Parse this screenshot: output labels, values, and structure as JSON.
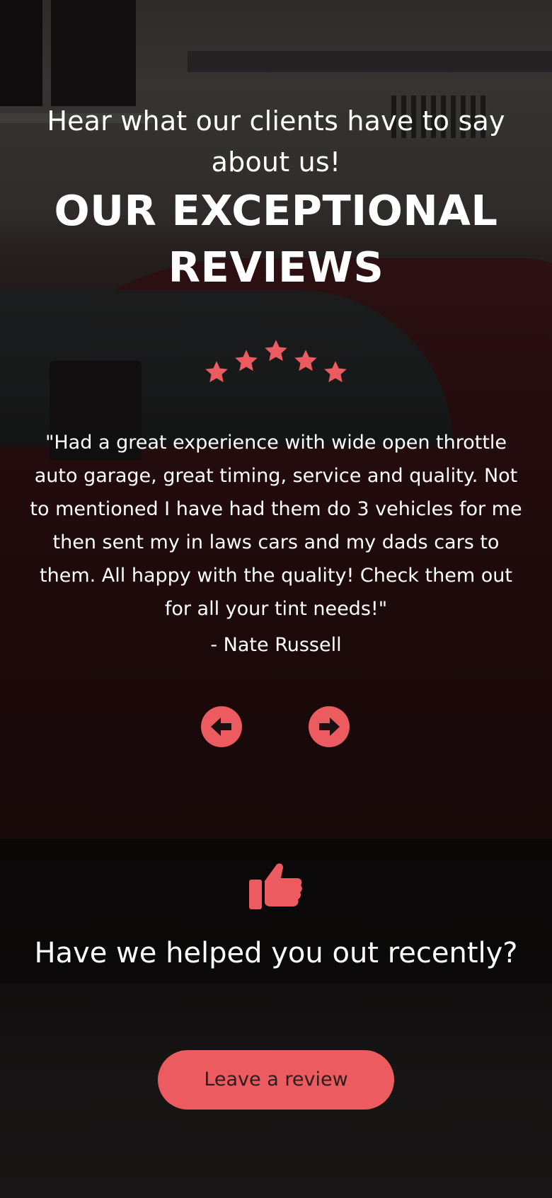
{
  "colors": {
    "accent": "#ec5b5f",
    "text": "#ffffff",
    "button_text": "#2a1e1e"
  },
  "header": {
    "subtitle": "Hear what our clients have to say about us!",
    "title": "OUR EXCEPTIONAL REVIEWS"
  },
  "rating": {
    "stars": 5,
    "icon": "star-icon"
  },
  "review": {
    "quote": "\"Had a great experience with wide open throttle auto garage, great timing, service and quality. Not to mentioned I have had them do 3 vehicles for me then sent my in laws cars and my dads cars to them. All happy with the quality! Check them out for all your tint needs!\"",
    "author": "- Nate Russell"
  },
  "carousel": {
    "prev_icon": "arrow-left-circle-icon",
    "next_icon": "arrow-right-circle-icon"
  },
  "cta": {
    "icon": "thumbs-up-icon",
    "text": "Have we helped you out recently?",
    "button_label": "Leave a review"
  }
}
